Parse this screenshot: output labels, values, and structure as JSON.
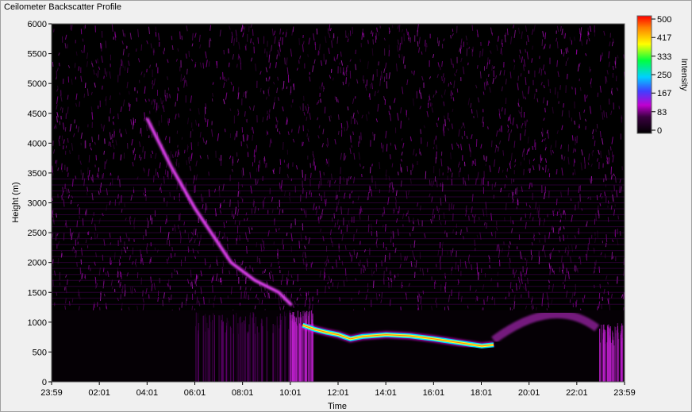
{
  "window": {
    "title": "Ceilometer Backscatter Profile"
  },
  "chart_data": {
    "type": "heatmap",
    "title": "Ceilometer Backscatter Profile",
    "xlabel": "Time",
    "ylabel": "Height (m)",
    "x_ticks": [
      "23:59",
      "02:01",
      "04:01",
      "06:01",
      "08:01",
      "10:01",
      "12:01",
      "14:01",
      "16:01",
      "18:01",
      "20:01",
      "22:01",
      "23:59"
    ],
    "y_ticks": [
      0,
      500,
      1000,
      1500,
      2000,
      2500,
      3000,
      3500,
      4000,
      4500,
      5000,
      5500,
      6000
    ],
    "ylim": [
      0,
      6000
    ],
    "colorbar": {
      "label": "Intensity",
      "ticks": [
        0,
        83,
        167,
        250,
        333,
        417,
        500
      ],
      "range": [
        0,
        500
      ]
    },
    "cloud_layer": [
      {
        "time": "10:30",
        "height": 950
      },
      {
        "time": "11:00",
        "height": 880
      },
      {
        "time": "11:30",
        "height": 830
      },
      {
        "time": "12:00",
        "height": 790
      },
      {
        "time": "12:30",
        "height": 720
      },
      {
        "time": "13:00",
        "height": 760
      },
      {
        "time": "14:00",
        "height": 790
      },
      {
        "time": "15:00",
        "height": 770
      },
      {
        "time": "16:00",
        "height": 720
      },
      {
        "time": "17:00",
        "height": 660
      },
      {
        "time": "18:00",
        "height": 600
      },
      {
        "time": "18:30",
        "height": 620
      }
    ],
    "descending_layer": [
      {
        "time": "04:00",
        "height": 4400
      },
      {
        "time": "05:00",
        "height": 3600
      },
      {
        "time": "06:00",
        "height": 2900
      },
      {
        "time": "07:30",
        "height": 2000
      },
      {
        "time": "08:30",
        "height": 1700
      },
      {
        "time": "09:30",
        "height": 1500
      },
      {
        "time": "10:00",
        "height": 1300
      }
    ],
    "grid": false
  }
}
